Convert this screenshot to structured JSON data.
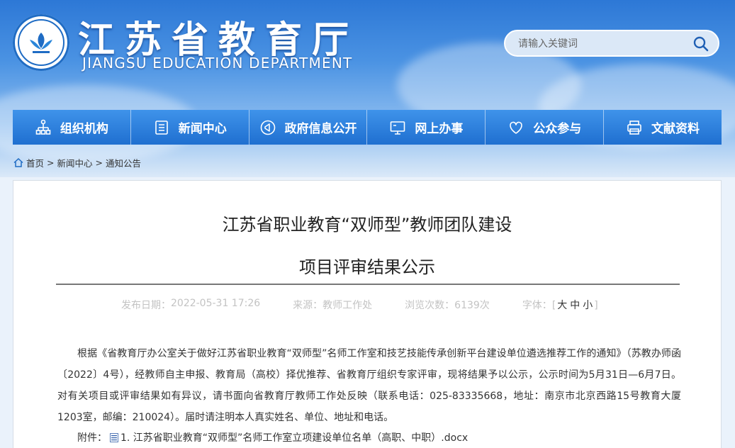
{
  "header": {
    "site_name_cn": "江苏省教育厅",
    "site_name_en": "JIANGSU EDUCATION DEPARTMENT",
    "search_placeholder": "请输入关键词"
  },
  "nav": [
    {
      "label": "组织机构",
      "icon": "org-chart-icon"
    },
    {
      "label": "新闻中心",
      "icon": "document-list-icon"
    },
    {
      "label": "政府信息公开",
      "icon": "megaphone-icon"
    },
    {
      "label": "网上办事",
      "icon": "monitor-icon"
    },
    {
      "label": "公众参与",
      "icon": "heart-icon"
    },
    {
      "label": "文献资料",
      "icon": "printer-icon"
    }
  ],
  "breadcrumb": [
    "首页",
    "新闻中心",
    "通知公告"
  ],
  "article": {
    "title_line1": "江苏省职业教育“双师型”教师团队建设",
    "title_line2": "项目评审结果公示",
    "publish_label": "发布日期：",
    "publish_date": "2022-05-31 17:26",
    "source_label": "来源：",
    "source": "教师工作处",
    "views_label": "浏览次数：",
    "views": "6139次",
    "font_label": "字体：",
    "font_large": "大",
    "font_medium": "中",
    "font_small": "小",
    "body": "根据《省教育厅办公室关于做好江苏省职业教育“双师型”名师工作室和技艺技能传承创新平台建设单位遴选推荐工作的通知》（苏教办师函〔2022〕4号），经教师自主申报、教育局（高校）择优推荐、省教育厅组织专家评审，现将结果予以公示，公示时间为5月31日—6月7日。对有关项目或评审结果如有异议，请书面向省教育厅教师工作处反映（联系电话：025-83335668，地址：南京市北京西路15号教育大厦1203室，邮编：210024）。届时请注明本人真实姓名、单位、地址和电话。",
    "attachment_label": "附件：",
    "attachment_1": "1. 江苏省职业教育“双师型”名师工作室立项建设单位名单（高职、中职）.docx"
  },
  "colors": {
    "nav_top": "#3f93ea",
    "nav_bottom": "#1f6fd0",
    "banner": "#2d78d6"
  }
}
